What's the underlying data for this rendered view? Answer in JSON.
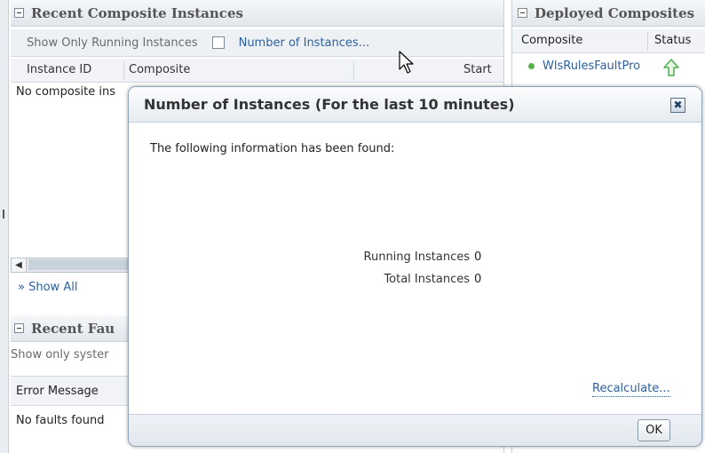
{
  "recent_instances": {
    "title": "Recent Composite Instances",
    "show_only_running_label": "Show Only Running Instances",
    "number_of_instances_link": "Number of Instances...",
    "columns": [
      "Instance ID",
      "Composite",
      "Start"
    ],
    "empty_text_partial": "No composite ins",
    "show_all": "Show All"
  },
  "recent_faults": {
    "title_partial": "Recent Fau",
    "filter_partial": "Show only syster",
    "columns": [
      "Error Message"
    ],
    "empty_text": "No faults found"
  },
  "deployed": {
    "title": "Deployed Composites",
    "columns": [
      "Composite",
      "Status"
    ],
    "rows": [
      {
        "name": "WlsRulesFaultPro",
        "status_icon": "up-arrow-icon",
        "status_color": "#4caf50"
      }
    ]
  },
  "dialog": {
    "title": "Number of Instances (For the last 10 minutes)",
    "close_glyph": "✖",
    "message": "The following information has been found:",
    "stats": [
      {
        "label": "Running Instances",
        "value": "0"
      },
      {
        "label": "Total Instances",
        "value": "0"
      }
    ],
    "recalculate": "Recalculate...",
    "ok": "OK"
  },
  "colors": {
    "link": "#2a5fa0",
    "accent_border": "#8fa3b7",
    "status_green": "#58b04a"
  }
}
